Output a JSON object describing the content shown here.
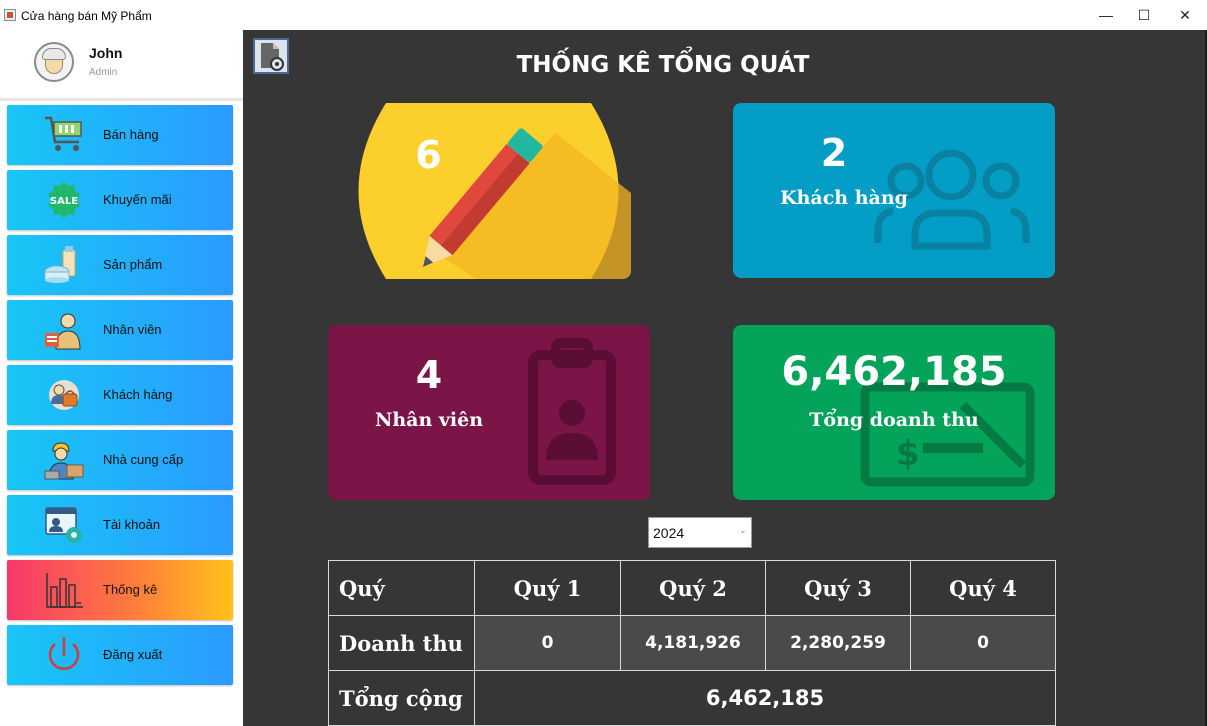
{
  "window": {
    "title": "Cửa hàng bán Mỹ Phẩm",
    "minimize": "—",
    "maximize": "☐",
    "close": "✕"
  },
  "user": {
    "name": "John",
    "role": "Admin"
  },
  "sidebar": {
    "items": [
      {
        "label": "Bán hàng",
        "icon": "shopping-cart-icon"
      },
      {
        "label": "Khuyến mãi",
        "icon": "sale-badge-icon"
      },
      {
        "label": "Sản phẩm",
        "icon": "cosmetics-icon"
      },
      {
        "label": "Nhân viên",
        "icon": "employee-icon"
      },
      {
        "label": "Khách hàng",
        "icon": "customer-icon"
      },
      {
        "label": "Nhà cung cấp",
        "icon": "supplier-icon"
      },
      {
        "label": "Tài khoản",
        "icon": "account-settings-icon"
      },
      {
        "label": "Thống kê",
        "icon": "bar-chart-icon",
        "active": true
      },
      {
        "label": "Đăng xuất",
        "icon": "power-icon"
      }
    ]
  },
  "main": {
    "title": "THỐNG KÊ TỔNG QUÁT",
    "cards": {
      "orders": {
        "value": "6",
        "color": "#fcd02c"
      },
      "customers": {
        "value": "2",
        "label": "Khách hàng",
        "color": "#039dc5"
      },
      "employees": {
        "value": "4",
        "label": "Nhân viên",
        "color": "#7b1447"
      },
      "revenue": {
        "value": "6,462,185",
        "label": "Tổng doanh thu",
        "color": "#03a35a"
      }
    },
    "year_select": {
      "value": "2024"
    },
    "table": {
      "header": [
        "Quý",
        "Quý 1",
        "Quý 2",
        "Quý 3",
        "Quý 4"
      ],
      "revenue_row": {
        "label": "Doanh thu",
        "values": [
          "0",
          "4,181,926",
          "2,280,259",
          "0"
        ]
      },
      "total_row": {
        "label": "Tổng cộng",
        "value": "6,462,185"
      }
    }
  },
  "colors": {
    "sidebar_item": "#2a9bff",
    "sidebar_active_start": "#f7386b",
    "sidebar_active_end": "#ffc21a",
    "main_background": "#363636"
  }
}
